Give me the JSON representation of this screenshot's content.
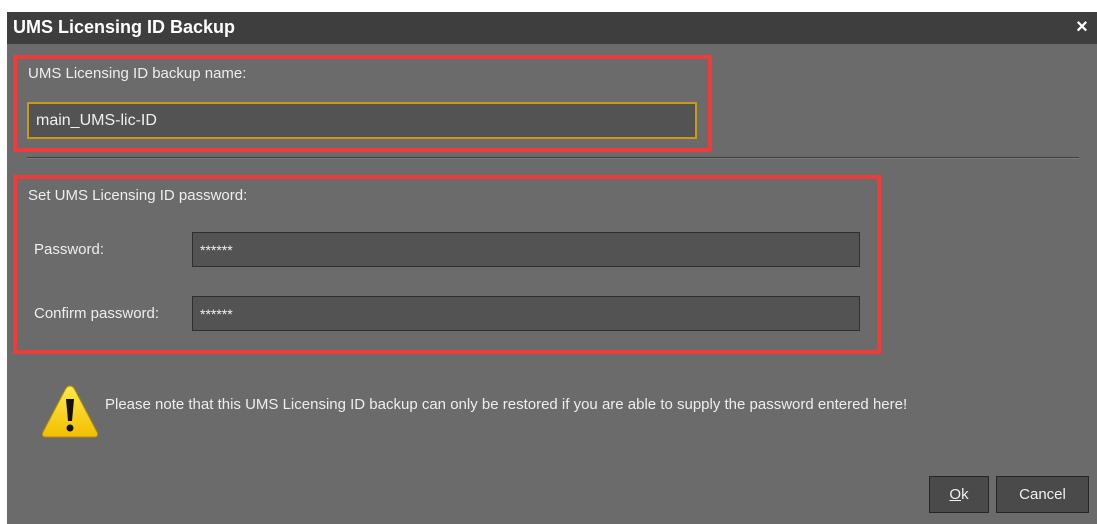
{
  "dialog": {
    "title": "UMS Licensing ID Backup",
    "close_label": "×"
  },
  "backup_name": {
    "label": "UMS Licensing ID backup name:",
    "value": "main_UMS-lic-ID"
  },
  "password_section": {
    "heading": "Set UMS Licensing ID password:",
    "password_label": "Password:",
    "password_value": "******",
    "confirm_label": "Confirm password:",
    "confirm_value": "******"
  },
  "warning": {
    "icon": "warning-icon",
    "text": "Please note that this UMS Licensing ID backup can only be restored if you are able to supply the password entered here!"
  },
  "buttons": {
    "ok_mnemonic": "O",
    "ok_rest": "k",
    "cancel": "Cancel"
  },
  "colors": {
    "background": "#6b6b6b",
    "titlebar": "#3e3e3e",
    "highlight": "#ee3b3b",
    "focus_border": "#c99a1a"
  }
}
